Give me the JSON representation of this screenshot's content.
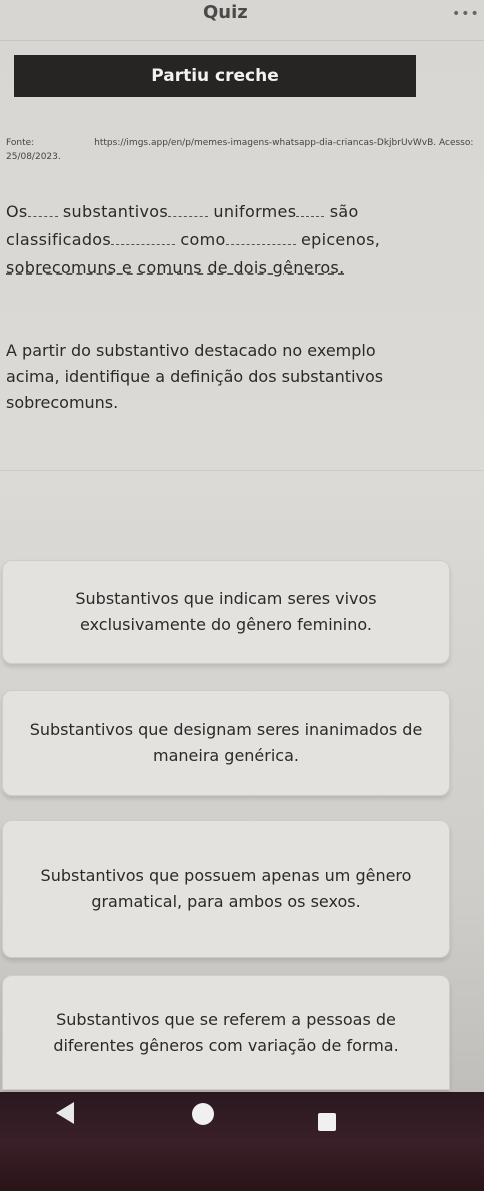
{
  "header": {
    "title": "Quiz",
    "menu_icon": "more-horizontal-icon"
  },
  "banner": {
    "title": "Partiu creche"
  },
  "source": {
    "label": "Fonte:",
    "url": "https://imgs.app/en/p/memes-imagens-whatsapp-dia-criancas-DkjbrUvWvB. Acesso: 25/08/2023."
  },
  "sentence": {
    "w1": "Os",
    "w2": "substantivos",
    "w3": "uniformes",
    "w4": "são",
    "w5": "classificados",
    "w6": "como",
    "w7": "epicenos,",
    "w8": "sobrecomuns e comuns de dois gêneros."
  },
  "question": {
    "text": "A partir do substantivo destacado no exemplo acima, identifique a definição dos substantivos sobrecomuns."
  },
  "options": [
    {
      "label": "Substantivos que indicam seres vivos exclusivamente do gênero feminino."
    },
    {
      "label": "Substantivos que designam seres inanimados de maneira genérica."
    },
    {
      "label": "Substantivos que possuem apenas um gênero gramatical, para ambos os sexos."
    },
    {
      "label": "Substantivos que se referem a pessoas de diferentes gêneros com variação de forma."
    }
  ],
  "navbar": {
    "back_icon": "back-triangle-icon",
    "home_icon": "home-circle-icon",
    "recent_icon": "recent-apps-square-icon"
  }
}
